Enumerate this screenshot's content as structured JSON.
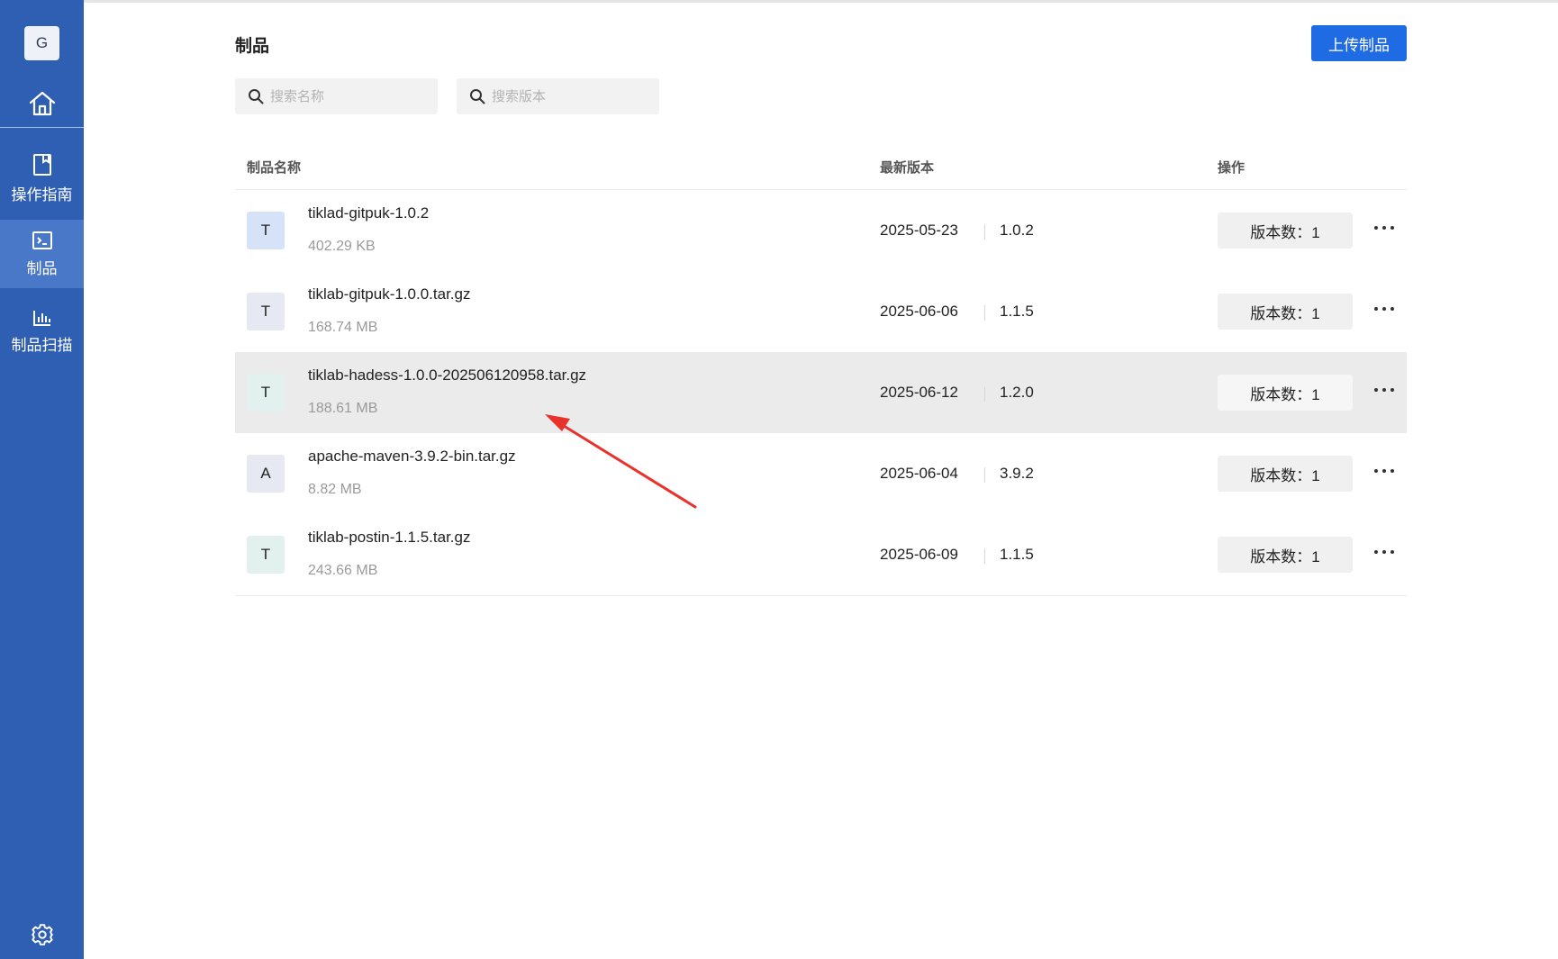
{
  "sidebar": {
    "logo_letter": "G",
    "items": [
      {
        "label": "操作指南",
        "icon": "book-icon"
      },
      {
        "label": "制品",
        "icon": "terminal-icon",
        "active": true
      },
      {
        "label": "制品扫描",
        "icon": "bar-chart-icon"
      }
    ],
    "home_icon": "home-icon",
    "settings_icon": "gear-icon"
  },
  "header": {
    "title": "制品",
    "upload_label": "上传制品"
  },
  "search": {
    "name_placeholder": "搜索名称",
    "version_placeholder": "搜索版本"
  },
  "table": {
    "columns": [
      "制品名称",
      "最新版本",
      "操作"
    ],
    "rows": [
      {
        "avatar": "T",
        "name": "tiklad-gitpuk-1.0.2",
        "size": "402.29 KB",
        "date": "2025-05-23",
        "version": "1.0.2",
        "count_label": "版本数：1"
      },
      {
        "avatar": "T",
        "name": "tiklab-gitpuk-1.0.0.tar.gz",
        "size": "168.74 MB",
        "date": "2025-06-06",
        "version": "1.1.5",
        "count_label": "版本数：1"
      },
      {
        "avatar": "T",
        "name": "tiklab-hadess-1.0.0-202506120958.tar.gz",
        "size": "188.61 MB",
        "date": "2025-06-12",
        "version": "1.2.0",
        "count_label": "版本数：1"
      },
      {
        "avatar": "A",
        "name": "apache-maven-3.9.2-bin.tar.gz",
        "size": "8.82 MB",
        "date": "2025-06-04",
        "version": "3.9.2",
        "count_label": "版本数：1"
      },
      {
        "avatar": "T",
        "name": "tiklab-postin-1.1.5.tar.gz",
        "size": "243.66 MB",
        "date": "2025-06-09",
        "version": "1.1.5",
        "count_label": "版本数：1"
      }
    ]
  },
  "colors": {
    "sidebar": "#2f5fb3",
    "sidebar_active": "#4a78c9",
    "primary": "#1e6be3",
    "annotation_arrow": "#e8322b"
  }
}
